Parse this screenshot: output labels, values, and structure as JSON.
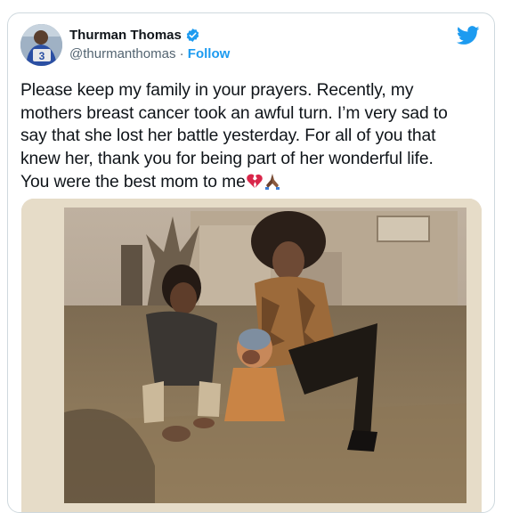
{
  "tweet": {
    "author_name": "Thurman Thomas",
    "handle": "@thurmanthomas",
    "separator": " · ",
    "follow_label": "Follow",
    "lines": [
      "Please keep my family in your prayers. Recently, my",
      "mothers breast cancer took an awful turn. I’m very  sad to",
      "say that she lost her battle yesterday. For all of you that",
      "knew her, thank you for being part of her wonderful life.",
      "You were the best mom to me"
    ],
    "emojis": [
      "broken-heart-icon",
      "folded-hands-icon"
    ]
  },
  "avatar_jersey_number": "3",
  "colors": {
    "accent": "#1d9bf0",
    "text": "#0f1419",
    "secondary": "#536471",
    "border": "#cfd9de"
  }
}
